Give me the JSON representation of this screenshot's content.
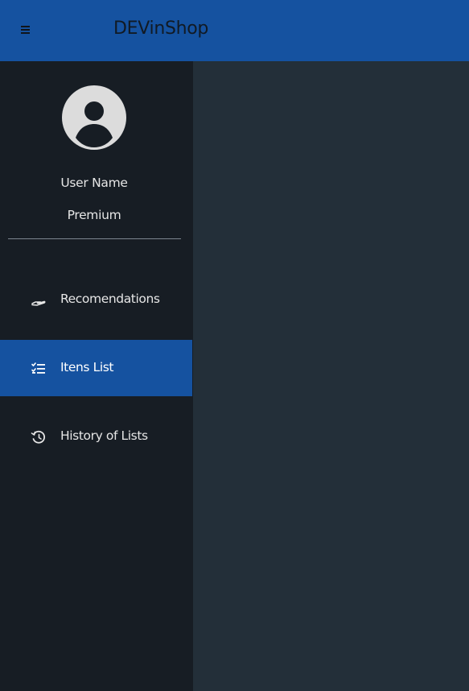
{
  "header": {
    "title": "DEVinShop",
    "menu_icon": "hamburger-menu-icon"
  },
  "sidebar": {
    "user": {
      "name": "User Name",
      "plan": "Premium",
      "avatar_icon": "account-circle-icon"
    },
    "items": [
      {
        "label": "Recomendations",
        "icon": "hand-holding-icon",
        "active": false
      },
      {
        "label": "Itens List",
        "icon": "checklist-icon",
        "active": true
      },
      {
        "label": "History of Lists",
        "icon": "history-icon",
        "active": false
      }
    ]
  },
  "colors": {
    "header_bg": "#1552a0",
    "sidebar_bg": "#171d24",
    "content_bg": "#232f39",
    "active_item_bg": "#1552a0"
  }
}
